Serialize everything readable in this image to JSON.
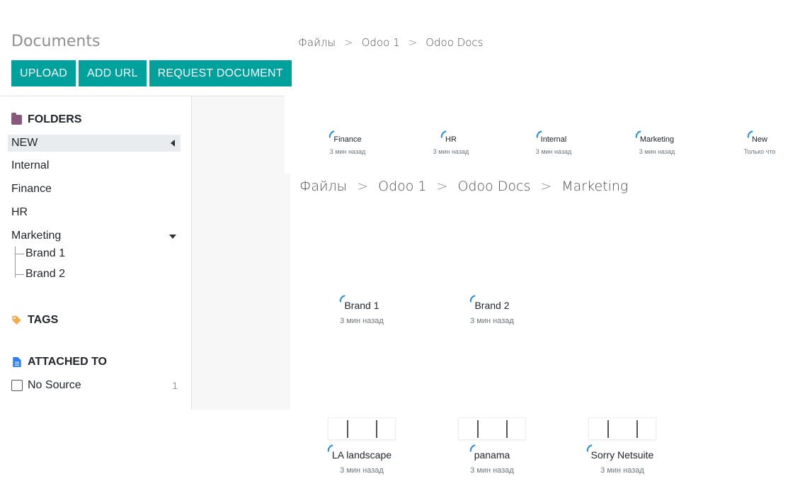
{
  "control_panel": {
    "title": "Documents",
    "buttons": {
      "upload": "UPLOAD",
      "add_url": "ADD URL",
      "request": "REQUEST DOCUMENT"
    },
    "accent_color": "#00a09d"
  },
  "breadcrumb_top": [
    "Файлы",
    "Odoo 1",
    "Odoo Docs"
  ],
  "breadcrumb_main": [
    "Файлы",
    "Odoo 1",
    "Odoo Docs",
    "Marketing"
  ],
  "breadcrumb_separator": ">",
  "sidebar": {
    "folders_label": "FOLDERS",
    "folders": {
      "new": "NEW",
      "internal": "Internal",
      "finance": "Finance",
      "hr": "HR",
      "marketing": "Marketing",
      "brand1": "Brand 1",
      "brand2": "Brand 2"
    },
    "tags_label": "TAGS",
    "attached_label": "ATTACHED TO",
    "no_source": {
      "label": "No Source",
      "count": "1"
    }
  },
  "top_folders": [
    {
      "name": "Finance",
      "time": "3 мин назад"
    },
    {
      "name": "HR",
      "time": "3 мин назад"
    },
    {
      "name": "Internal",
      "time": "3 мин назад"
    },
    {
      "name": "Marketing",
      "time": "3 мин назад"
    },
    {
      "name": "New",
      "time": "Только что"
    }
  ],
  "subfolders": [
    {
      "name": "Brand 1",
      "time": "3 мин назад"
    },
    {
      "name": "Brand 2",
      "time": "3 мин назад"
    }
  ],
  "documents": [
    {
      "name": "LA landscape",
      "time": "3 мин назад"
    },
    {
      "name": "panama",
      "time": "3 мин назад"
    },
    {
      "name": "Sorry Netsuite",
      "time": "3 мин назад"
    }
  ]
}
